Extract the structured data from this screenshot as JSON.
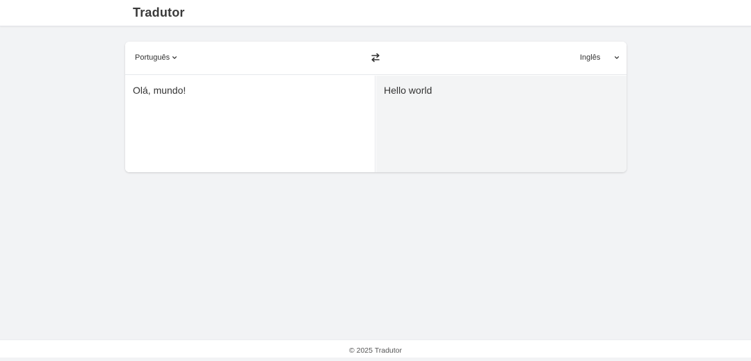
{
  "header": {
    "title": "Tradutor"
  },
  "toolbar": {
    "source_language": "Português",
    "target_language": "Inglês",
    "swap_icon": "swap-arrows-icon"
  },
  "source": {
    "text": "Olá, mundo!"
  },
  "target": {
    "text": "Hello world"
  },
  "footer": {
    "text": "© 2025 Tradutor"
  },
  "colors": {
    "background": "#f2f3f5",
    "card": "#ffffff",
    "output_pane": "#f3f4f5"
  }
}
